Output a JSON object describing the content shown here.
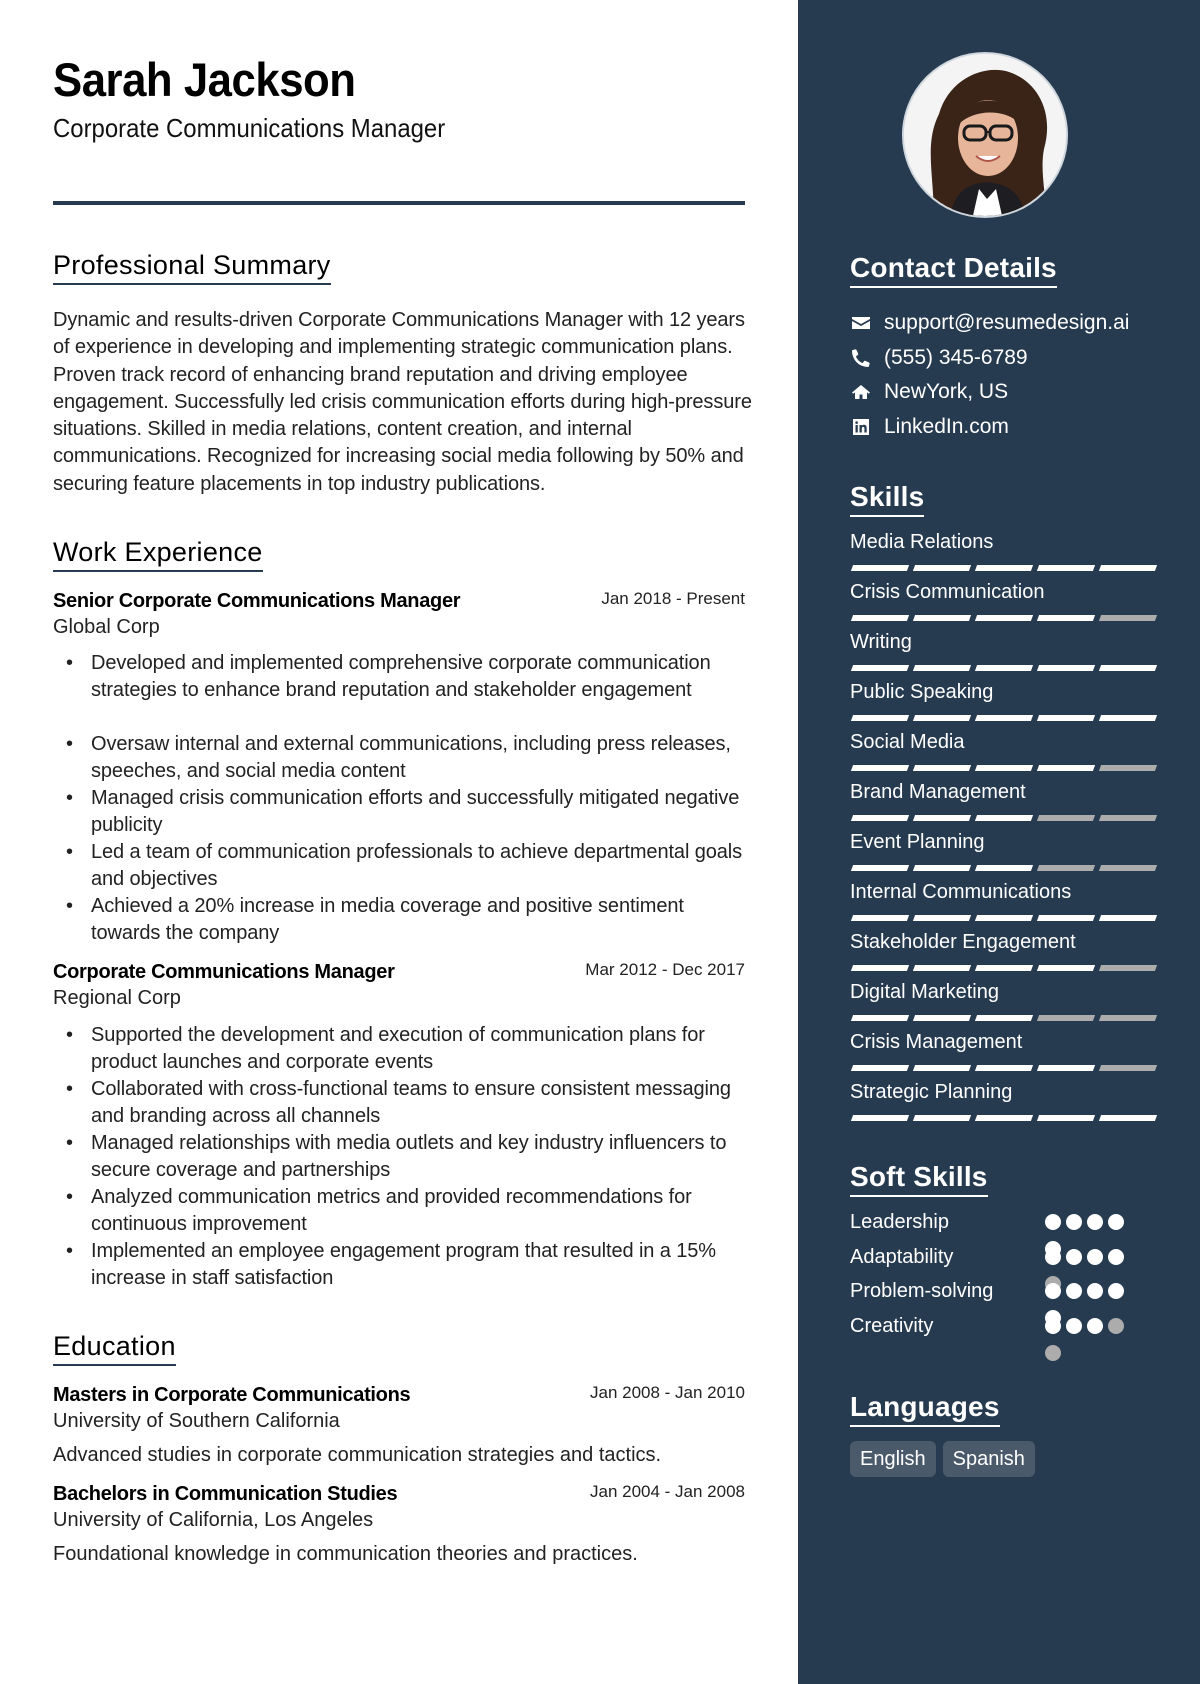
{
  "header": {
    "name": "Sarah Jackson",
    "title": "Corporate Communications Manager"
  },
  "summary": {
    "heading": "Professional Summary",
    "text": "Dynamic and results-driven Corporate Communications Manager with 12 years of experience in developing and implementing strategic communication plans. Proven track record of enhancing brand reputation and driving employee engagement. Successfully led crisis communication efforts during high-pressure situations. Skilled in media relations, content creation, and internal communications. Recognized for increasing social media following by 50% and securing feature placements in top industry publications."
  },
  "work": {
    "heading": "Work Experience",
    "jobs": [
      {
        "title": "Senior Corporate Communications Manager",
        "company": "Global Corp",
        "dates": "Jan 2018 - Present",
        "bullets": [
          "Developed and implemented comprehensive corporate communication strategies to enhance brand reputation and stakeholder engagement",
          "Oversaw internal and external communications, including press releases, speeches, and social media content",
          "Managed crisis communication efforts and successfully mitigated negative publicity",
          "Led a team of communication professionals to achieve departmental goals and objectives",
          "Achieved a 20% increase in media coverage and positive sentiment towards the company"
        ]
      },
      {
        "title": "Corporate Communications Manager",
        "company": "Regional Corp",
        "dates": "Mar 2012 - Dec 2017",
        "bullets": [
          "Supported the development and execution of communication plans for product launches and corporate events",
          "Collaborated with cross-functional teams to ensure consistent messaging and branding across all channels",
          "Managed relationships with media outlets and key industry influencers to secure coverage and partnerships",
          "Analyzed communication metrics and provided recommendations for continuous improvement",
          "Implemented an employee engagement program that resulted in a 15% increase in staff satisfaction"
        ]
      }
    ]
  },
  "education": {
    "heading": "Education",
    "items": [
      {
        "degree": "Masters in Corporate Communications",
        "school": "University of Southern California",
        "dates": "Jan 2008 - Jan 2010",
        "description": "Advanced studies in corporate communication strategies and tactics."
      },
      {
        "degree": "Bachelors in Communication Studies",
        "school": "University of California, Los Angeles",
        "dates": "Jan 2004 - Jan 2008",
        "description": "Foundational knowledge in communication theories and practices."
      }
    ]
  },
  "sidebar": {
    "photo_alt": "Profile photo of Sarah Jackson",
    "contact": {
      "heading": "Contact Details",
      "items": [
        {
          "icon": "envelope-icon",
          "text": "support@resumedesign.ai"
        },
        {
          "icon": "phone-icon",
          "text": "(555) 345-6789"
        },
        {
          "icon": "home-icon",
          "text": "NewYork, US"
        },
        {
          "icon": "linkedin-icon",
          "text": "LinkedIn.com"
        }
      ]
    },
    "skills": {
      "heading": "Skills",
      "max": 5,
      "items": [
        {
          "name": "Media Relations",
          "level": 5
        },
        {
          "name": "Crisis Communication",
          "level": 4
        },
        {
          "name": "Writing",
          "level": 5
        },
        {
          "name": "Public Speaking",
          "level": 5
        },
        {
          "name": "Social Media",
          "level": 4
        },
        {
          "name": "Brand Management",
          "level": 3
        },
        {
          "name": "Event Planning",
          "level": 3
        },
        {
          "name": "Internal Communications",
          "level": 5
        },
        {
          "name": "Stakeholder Engagement",
          "level": 4
        },
        {
          "name": "Digital Marketing",
          "level": 3
        },
        {
          "name": "Crisis Management",
          "level": 4
        },
        {
          "name": "Strategic Planning",
          "level": 5
        }
      ]
    },
    "soft_skills": {
      "heading": "Soft Skills",
      "max": 5,
      "items": [
        {
          "name": "Leadership",
          "level": 5
        },
        {
          "name": "Adaptability",
          "level": 4
        },
        {
          "name": "Problem-solving",
          "level": 5
        },
        {
          "name": "Creativity",
          "level": 3
        }
      ]
    },
    "languages": {
      "heading": "Languages",
      "items": [
        "English",
        "Spanish"
      ]
    }
  },
  "colors": {
    "sidebar_bg": "#273b50",
    "rating_on": "#ffffff",
    "rating_off": "#acacac",
    "language_chip": "#4a5a6b"
  }
}
